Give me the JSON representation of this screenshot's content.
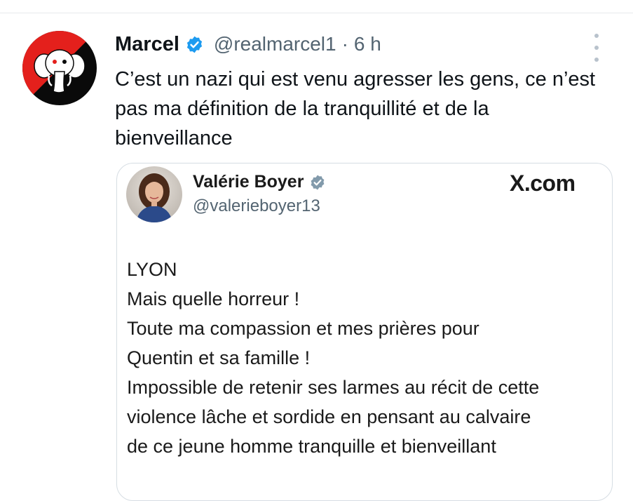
{
  "tweet": {
    "display_name": "Marcel",
    "handle": "@realmarcel1",
    "separator": "·",
    "timestamp": "6 h",
    "text": "C’est un nazi qui est venu agresser les gens, ce n’est pas ma définition de la tranquillité et de la bienveillance",
    "avatar_icon": "red-black-elephant-logo",
    "verified_icon": "verified-badge-icon",
    "more_icon": "more-options-icon",
    "colors": {
      "avatar_red": "#e4201c",
      "avatar_black": "#0a0a0a",
      "verified_blue": "#1d9bf0",
      "secondary_text": "#536471"
    }
  },
  "quote": {
    "display_name": "Valérie Boyer",
    "handle": "@valerieboyer13",
    "source": "X.com",
    "verified_icon": "grey-verified-badge-icon",
    "lines": [
      "LYON",
      "Mais quelle horreur !",
      "Toute ma compassion et mes prières pour",
      "Quentin et sa famille !",
      "Impossible de retenir ses larmes au récit de cette",
      "violence lâche et sordide en pensant au calvaire",
      "de ce jeune homme tranquille et bienveillant"
    ]
  }
}
